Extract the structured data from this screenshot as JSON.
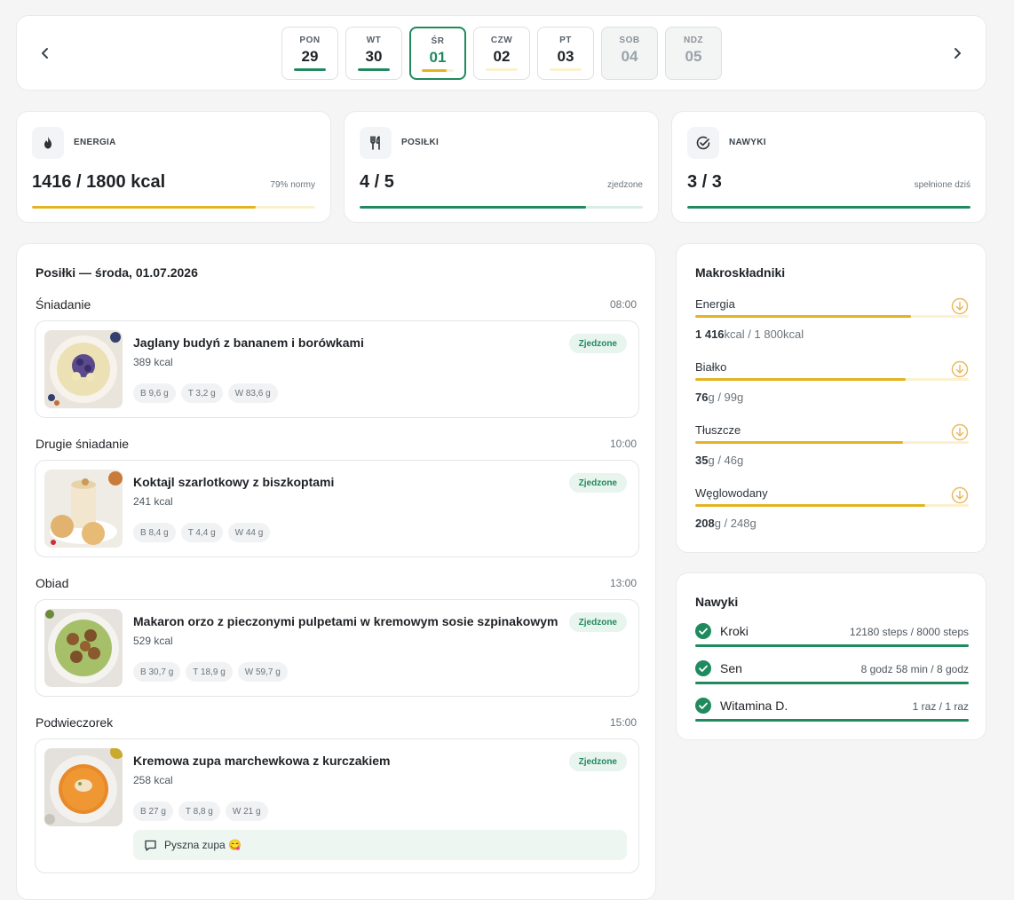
{
  "colors": {
    "accent_green": "#1f8a5e",
    "accent_yellow": "#e3b321",
    "light_yellow": "#fbf1cf",
    "light_green": "#d9ede3"
  },
  "datebar": {
    "prev_icon": "chevron-left-icon",
    "next_icon": "chevron-right-icon",
    "days": [
      {
        "name": "PON",
        "date": "29",
        "progress": 1.0,
        "color": "#1f8a5e",
        "state": "past"
      },
      {
        "name": "WT",
        "date": "30",
        "progress": 1.0,
        "color": "#1f8a5e",
        "state": "past"
      },
      {
        "name": "ŚR",
        "date": "01",
        "progress": 0.79,
        "color": "#e3b321",
        "state": "selected"
      },
      {
        "name": "CZW",
        "date": "02",
        "progress": 0.0,
        "color": "#e3b321",
        "state": "upcoming"
      },
      {
        "name": "PT",
        "date": "03",
        "progress": 0.0,
        "color": "#e3b321",
        "state": "upcoming"
      },
      {
        "name": "SOB",
        "date": "04",
        "progress": 0.0,
        "color": "#e3b321",
        "state": "future"
      },
      {
        "name": "NDZ",
        "date": "05",
        "progress": 0.0,
        "color": "#e3b321",
        "state": "future"
      }
    ]
  },
  "stats": {
    "energy": {
      "label": "ENERGIA",
      "value": "1416 / 1800 kcal",
      "sub": "79% normy",
      "progress": 0.79,
      "icon": "flame-icon"
    },
    "meals": {
      "label": "POSIŁKI",
      "value": "4 / 5",
      "sub": "zjedzone",
      "progress": 0.8,
      "icon": "cutlery-icon"
    },
    "habits": {
      "label": "NAWYKI",
      "value": "3 / 3",
      "sub": "spełnione dziś",
      "progress": 1.0,
      "icon": "check-circle-icon"
    }
  },
  "meals_panel": {
    "title": "Posiłki — środa, 01.07.2026",
    "sections": [
      {
        "name": "Śniadanie",
        "time": "08:00",
        "meal": {
          "name": "Jaglany budyń z bananem i borówkami",
          "kcal": "389 kcal",
          "badge": "Zjedzone",
          "tags": [
            "B 9,6 g",
            "T 3,2 g",
            "W 83,6 g"
          ]
        }
      },
      {
        "name": "Drugie śniadanie",
        "time": "10:00",
        "meal": {
          "name": "Koktajl szarlotkowy z biszkoptami",
          "kcal": "241 kcal",
          "badge": "Zjedzone",
          "tags": [
            "B 8,4 g",
            "T 4,4 g",
            "W 44 g"
          ]
        }
      },
      {
        "name": "Obiad",
        "time": "13:00",
        "meal": {
          "name": "Makaron orzo z pieczonymi pulpetami w kremowym sosie szpinakowym",
          "kcal": "529 kcal",
          "badge": "Zjedzone",
          "tags": [
            "B 30,7 g",
            "T 18,9 g",
            "W 59,7 g"
          ]
        }
      },
      {
        "name": "Podwieczorek",
        "time": "15:00",
        "meal": {
          "name": "Kremowa zupa marchewkowa z kurczakiem",
          "kcal": "258 kcal",
          "badge": "Zjedzone",
          "tags": [
            "B 27 g",
            "T 8,8 g",
            "W 21 g"
          ],
          "note": "Pyszna zupa 😋"
        }
      }
    ]
  },
  "macros": {
    "title": "Makroskładniki",
    "items": [
      {
        "label": "Energia",
        "value": "1 416",
        "unit": "kcal",
        "target": " / 1 800kcal",
        "progress": 0.79,
        "icon": "arrow-down-circle-icon"
      },
      {
        "label": "Białko",
        "value": "76",
        "unit": "g",
        "target": " / 99g",
        "progress": 0.77,
        "icon": "arrow-down-circle-icon"
      },
      {
        "label": "Tłuszcze",
        "value": "35",
        "unit": "g",
        "target": " / 46g",
        "progress": 0.76,
        "icon": "arrow-down-circle-icon"
      },
      {
        "label": "Węglowodany",
        "value": "208",
        "unit": "g",
        "target": " / 248g",
        "progress": 0.84,
        "icon": "arrow-down-circle-icon"
      }
    ]
  },
  "habits": {
    "title": "Nawyki",
    "items": [
      {
        "name": "Kroki",
        "value": "12180 steps / 8000 steps",
        "icon": "check-circle-icon"
      },
      {
        "name": "Sen",
        "value": "8 godz 58 min / 8 godz",
        "icon": "check-circle-icon"
      },
      {
        "name": "Witamina D.",
        "value": "1 raz / 1 raz",
        "icon": "check-circle-icon"
      }
    ]
  }
}
